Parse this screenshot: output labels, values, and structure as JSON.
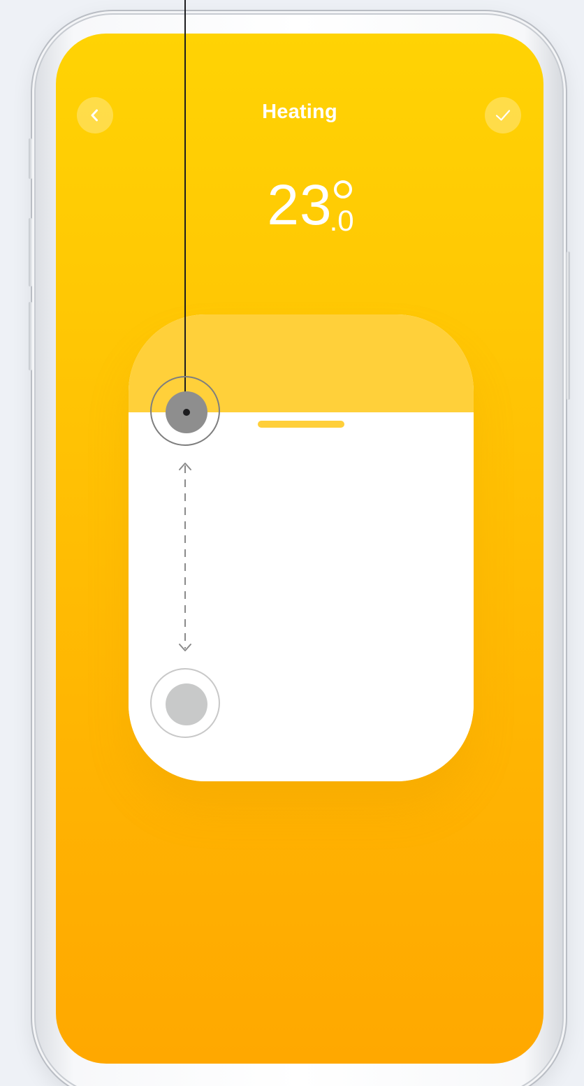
{
  "screen": {
    "title": "Heating",
    "back_icon": "chevron-left-icon",
    "confirm_icon": "checkmark-icon"
  },
  "temperature": {
    "whole": "23",
    "decimal": ".0",
    "unit_symbol": "degree-icon"
  },
  "slider": {
    "value_fraction": 0.79
  },
  "gesture_hint": {
    "description_icon": "drag-vertical-icon"
  },
  "colors": {
    "accent_top": "#ffd304",
    "accent_bottom": "#ffa800",
    "slider_empty": "#ffd03a",
    "slider_fill": "#ffffff",
    "touch_active": "#8e8e8e",
    "touch_inactive": "#c8c9c9"
  }
}
